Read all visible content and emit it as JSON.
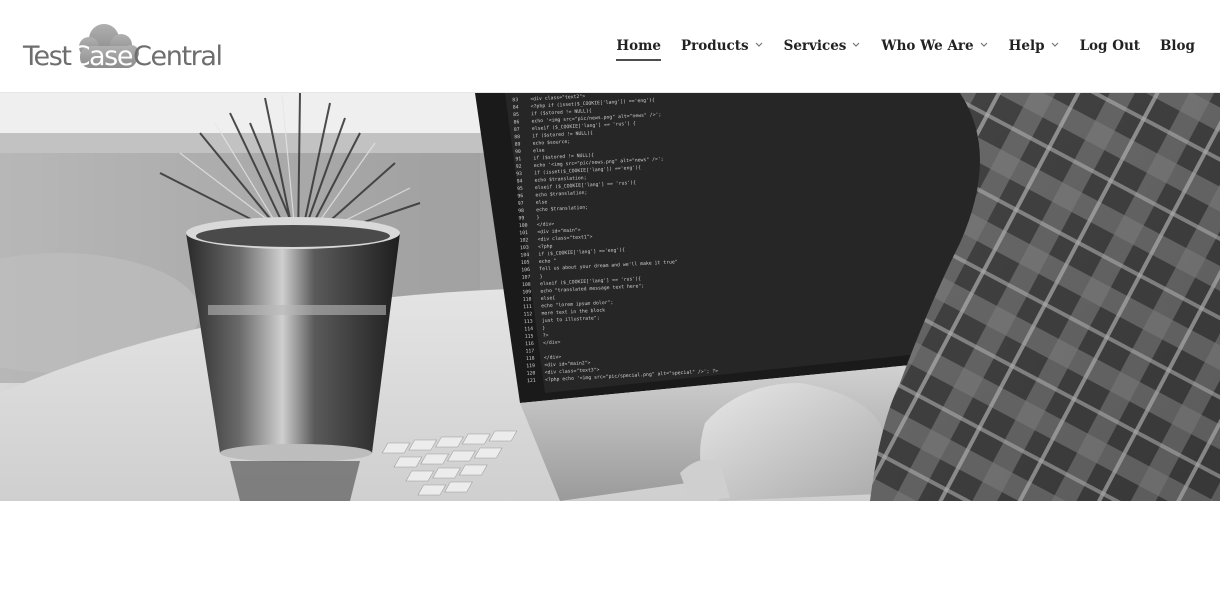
{
  "logo": {
    "text_left": "Test",
    "text_mid": "Case",
    "text_right": "Central"
  },
  "nav": [
    {
      "label": "Home",
      "has_dropdown": false,
      "active": true
    },
    {
      "label": "Products",
      "has_dropdown": true,
      "active": false
    },
    {
      "label": "Services",
      "has_dropdown": true,
      "active": false
    },
    {
      "label": "Who We Are",
      "has_dropdown": true,
      "active": false
    },
    {
      "label": "Help",
      "has_dropdown": true,
      "active": false
    },
    {
      "label": "Log Out",
      "has_dropdown": false,
      "active": false
    },
    {
      "label": "Blog",
      "has_dropdown": false,
      "active": false
    }
  ],
  "hero": {
    "image_icon": "person-coding-on-laptop-photo",
    "code_lines": [
      "<div class=\"text2\">",
      "<?php if (isset($_COOKIE['lang']) =='eng'){",
      "  if ($stored != NULL){",
      "    echo '<img src=\"pic/news.png\" alt=\"news\" />';",
      "    elseif ($_COOKIE['lang'] == 'rus') {",
      "      if ($stored != NULL){",
      "  echo $source;",
      "else",
      "  if ($stored != NULL){",
      "  echo '<img src=\"pic/news.png\" alt=\"news\" />';",
      "  if (isset($_COOKIE['lang']) =='eng'){",
      "    echo $translation;",
      "    elseif ($_COOKIE['lang'] == 'rus'){",
      "  echo $translation;",
      "else",
      "  echo $translation;",
      "  }",
      "</div>",
      "<div id=\"main\">",
      "<div class=\"text1\">",
      "  <?php",
      "  if ($_COOKIE['lang'] =='eng'){",
      "    echo \"",
      "    Tell us about your dream and we'll make it true\"",
      "  }",
      "  elseif ($_COOKIE['lang'] == 'rus'){",
      "    echo \"translated message text here\";",
      "  else{",
      "    echo \"lorem ipsum dolor\";",
      "    more text in the block",
      "    just to illustrate\";",
      "  }",
      "  ?>",
      "</div>",
      "",
      "</div>",
      "<div id=\"main2\">",
      "<div class=\"text3\">",
      "<?php echo '<img src=\"pic/special.png\" alt=\"special\" />'; ?>"
    ],
    "colors": {
      "background_wall": "#bdbdbd",
      "table": "#d9d9d9",
      "screen": "#262626",
      "laptop_body": "#bfbfbf",
      "shirt_dark": "#3a3a3a",
      "shirt_light": "#8a8a8a"
    }
  }
}
